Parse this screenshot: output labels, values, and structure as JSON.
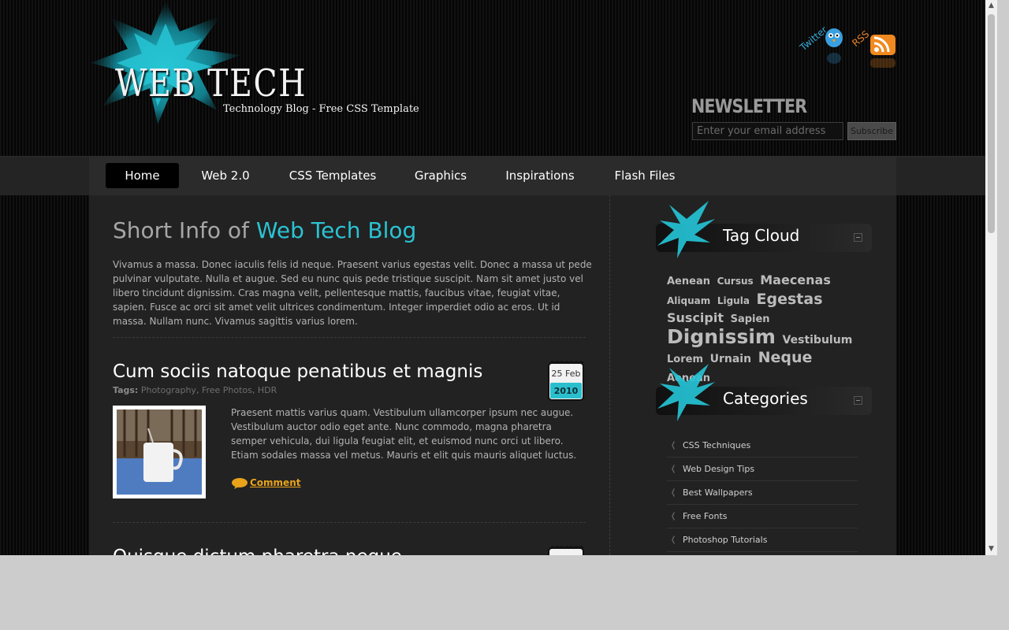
{
  "header": {
    "site_title": "WEB TECH",
    "tagline": "Technology Blog - Free CSS Template",
    "social": {
      "twitter_label": "Twitter",
      "rss_label": "RSS"
    },
    "newsletter": {
      "title": "NEWSLETTER",
      "email_placeholder": "Enter your email address",
      "submit_label": "Subscribe"
    }
  },
  "nav": {
    "items": [
      {
        "label": "Home",
        "active": true
      },
      {
        "label": "Web 2.0"
      },
      {
        "label": "CSS Templates"
      },
      {
        "label": "Graphics"
      },
      {
        "label": "Inspirations"
      },
      {
        "label": "Flash Files"
      }
    ]
  },
  "intro": {
    "title_plain": "Short Info of ",
    "title_accent": "Web Tech Blog",
    "text": "Vivamus a massa. Donec iaculis felis id neque. Praesent varius egestas velit. Donec a massa ut pede pulvinar vulputate. Nulla et augue. Sed eu nunc quis pede tristique suscipit. Nam sit amet justo vel libero tincidunt dignissim. Cras magna velit, pellentesque mattis, faucibus vitae, feugiat vitae, sapien. Fusce ac orci sit amet velit ultrices condimentum. Integer imperdiet odio ac eros. Ut id massa. Nullam nunc. Vivamus sagittis varius lorem."
  },
  "posts": [
    {
      "title": "Cum sociis natoque penatibus et magnis",
      "tags_label": "Tags:",
      "tags": [
        "Photography",
        "Free Photos",
        "HDR"
      ],
      "date_day": "25 Feb",
      "date_year": "2010",
      "excerpt": "Praesent mattis varius quam. Vestibulum ullamcorper ipsum nec augue. Vestibulum auctor odio eget ante. Nunc commodo, magna pharetra semper vehicula, dui ligula feugiat elit, et euismod nunc orci ut libero. Etiam sodales massa vel metus. Mauris et elit quis mauris aliquet luctus.",
      "comment_label": "Comment"
    },
    {
      "title": "Quisque dictum pharetra neque"
    }
  ],
  "sidebar": {
    "tag_cloud_title": "Tag Cloud",
    "tags": [
      {
        "text": "Aenean",
        "size": "small"
      },
      {
        "text": "Cursus",
        "size": "small"
      },
      {
        "text": "Maecenas",
        "size": "medium"
      },
      {
        "text": "Aliquam",
        "size": "small"
      },
      {
        "text": "Ligula",
        "size": "small"
      },
      {
        "text": "Egestas",
        "size": "large"
      },
      {
        "text": "Suscipit",
        "size": "medium"
      },
      {
        "text": "Sapien",
        "size": "small"
      },
      {
        "text": "Dignissim",
        "size": "xlarge"
      },
      {
        "text": "Vestibulum",
        "size": "medium-small"
      },
      {
        "text": "Lorem",
        "size": "small"
      },
      {
        "text": "Urnain",
        "size": "medium-small"
      },
      {
        "text": "Neque",
        "size": "large"
      },
      {
        "text": "Aenean",
        "size": "small"
      }
    ],
    "categories_title": "Categories",
    "categories": [
      "CSS Techniques",
      "Web Design Tips",
      "Best Wallpapers",
      "Free Fonts",
      "Photoshop Tutorials"
    ]
  },
  "colors": {
    "accent": "#2bc3d3",
    "comment": "#e8a31b",
    "rss": "#e78226",
    "twitter": "#3aa9d8"
  }
}
